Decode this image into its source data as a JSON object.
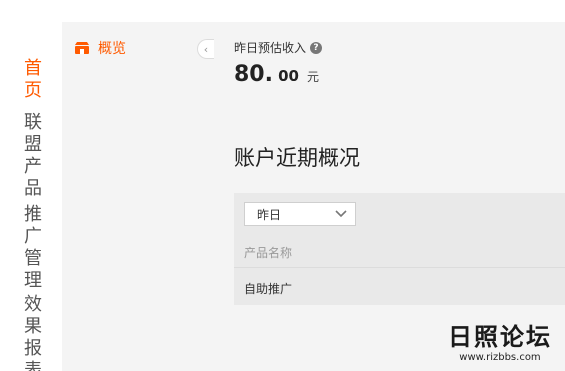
{
  "nav": {
    "groups": [
      {
        "label": "首页",
        "active": true
      },
      {
        "label": "联盟产品",
        "active": false
      },
      {
        "label": "推广管理",
        "active": false
      },
      {
        "label": "效果报表",
        "active": false
      }
    ]
  },
  "subnav": {
    "overview_label": "概览",
    "overview_icon": "store-icon",
    "collapse_icon": "chevron-left-icon"
  },
  "income": {
    "label": "昨日预估收入",
    "value_int": "80.",
    "value_dec": "00",
    "unit": "元"
  },
  "account": {
    "title": "账户近期概况",
    "period_selected": "昨日",
    "column_header": "产品名称",
    "rows": [
      "自助推广"
    ]
  },
  "watermark": {
    "title": "日照论坛",
    "url": "www.rizbbs.com"
  },
  "colors": {
    "accent": "#ff5a00"
  }
}
